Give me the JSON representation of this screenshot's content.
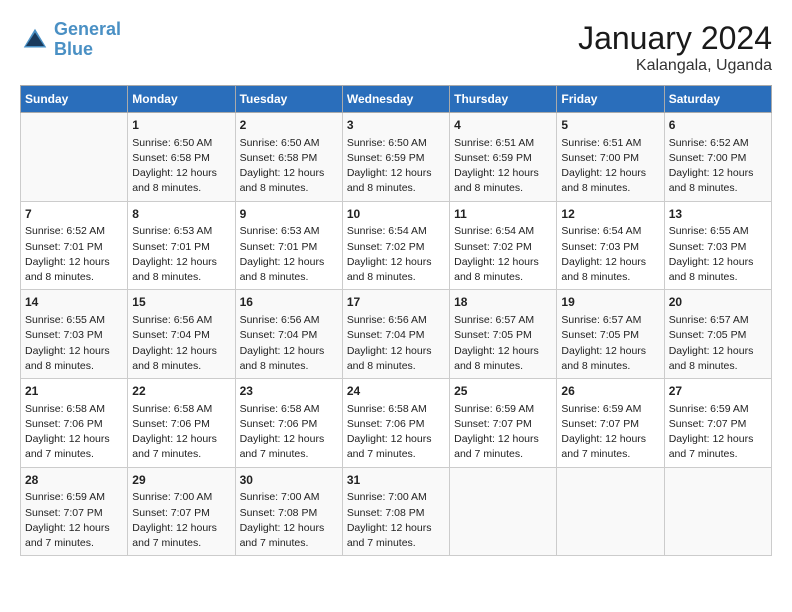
{
  "header": {
    "logo_line1": "General",
    "logo_line2": "Blue",
    "title": "January 2024",
    "subtitle": "Kalangala, Uganda"
  },
  "days_of_week": [
    "Sunday",
    "Monday",
    "Tuesday",
    "Wednesday",
    "Thursday",
    "Friday",
    "Saturday"
  ],
  "weeks": [
    [
      {
        "day": "",
        "info": ""
      },
      {
        "day": "1",
        "info": "Sunrise: 6:50 AM\nSunset: 6:58 PM\nDaylight: 12 hours\nand 8 minutes."
      },
      {
        "day": "2",
        "info": "Sunrise: 6:50 AM\nSunset: 6:58 PM\nDaylight: 12 hours\nand 8 minutes."
      },
      {
        "day": "3",
        "info": "Sunrise: 6:50 AM\nSunset: 6:59 PM\nDaylight: 12 hours\nand 8 minutes."
      },
      {
        "day": "4",
        "info": "Sunrise: 6:51 AM\nSunset: 6:59 PM\nDaylight: 12 hours\nand 8 minutes."
      },
      {
        "day": "5",
        "info": "Sunrise: 6:51 AM\nSunset: 7:00 PM\nDaylight: 12 hours\nand 8 minutes."
      },
      {
        "day": "6",
        "info": "Sunrise: 6:52 AM\nSunset: 7:00 PM\nDaylight: 12 hours\nand 8 minutes."
      }
    ],
    [
      {
        "day": "7",
        "info": "Sunrise: 6:52 AM\nSunset: 7:01 PM\nDaylight: 12 hours\nand 8 minutes."
      },
      {
        "day": "8",
        "info": "Sunrise: 6:53 AM\nSunset: 7:01 PM\nDaylight: 12 hours\nand 8 minutes."
      },
      {
        "day": "9",
        "info": "Sunrise: 6:53 AM\nSunset: 7:01 PM\nDaylight: 12 hours\nand 8 minutes."
      },
      {
        "day": "10",
        "info": "Sunrise: 6:54 AM\nSunset: 7:02 PM\nDaylight: 12 hours\nand 8 minutes."
      },
      {
        "day": "11",
        "info": "Sunrise: 6:54 AM\nSunset: 7:02 PM\nDaylight: 12 hours\nand 8 minutes."
      },
      {
        "day": "12",
        "info": "Sunrise: 6:54 AM\nSunset: 7:03 PM\nDaylight: 12 hours\nand 8 minutes."
      },
      {
        "day": "13",
        "info": "Sunrise: 6:55 AM\nSunset: 7:03 PM\nDaylight: 12 hours\nand 8 minutes."
      }
    ],
    [
      {
        "day": "14",
        "info": "Sunrise: 6:55 AM\nSunset: 7:03 PM\nDaylight: 12 hours\nand 8 minutes."
      },
      {
        "day": "15",
        "info": "Sunrise: 6:56 AM\nSunset: 7:04 PM\nDaylight: 12 hours\nand 8 minutes."
      },
      {
        "day": "16",
        "info": "Sunrise: 6:56 AM\nSunset: 7:04 PM\nDaylight: 12 hours\nand 8 minutes."
      },
      {
        "day": "17",
        "info": "Sunrise: 6:56 AM\nSunset: 7:04 PM\nDaylight: 12 hours\nand 8 minutes."
      },
      {
        "day": "18",
        "info": "Sunrise: 6:57 AM\nSunset: 7:05 PM\nDaylight: 12 hours\nand 8 minutes."
      },
      {
        "day": "19",
        "info": "Sunrise: 6:57 AM\nSunset: 7:05 PM\nDaylight: 12 hours\nand 8 minutes."
      },
      {
        "day": "20",
        "info": "Sunrise: 6:57 AM\nSunset: 7:05 PM\nDaylight: 12 hours\nand 8 minutes."
      }
    ],
    [
      {
        "day": "21",
        "info": "Sunrise: 6:58 AM\nSunset: 7:06 PM\nDaylight: 12 hours\nand 7 minutes."
      },
      {
        "day": "22",
        "info": "Sunrise: 6:58 AM\nSunset: 7:06 PM\nDaylight: 12 hours\nand 7 minutes."
      },
      {
        "day": "23",
        "info": "Sunrise: 6:58 AM\nSunset: 7:06 PM\nDaylight: 12 hours\nand 7 minutes."
      },
      {
        "day": "24",
        "info": "Sunrise: 6:58 AM\nSunset: 7:06 PM\nDaylight: 12 hours\nand 7 minutes."
      },
      {
        "day": "25",
        "info": "Sunrise: 6:59 AM\nSunset: 7:07 PM\nDaylight: 12 hours\nand 7 minutes."
      },
      {
        "day": "26",
        "info": "Sunrise: 6:59 AM\nSunset: 7:07 PM\nDaylight: 12 hours\nand 7 minutes."
      },
      {
        "day": "27",
        "info": "Sunrise: 6:59 AM\nSunset: 7:07 PM\nDaylight: 12 hours\nand 7 minutes."
      }
    ],
    [
      {
        "day": "28",
        "info": "Sunrise: 6:59 AM\nSunset: 7:07 PM\nDaylight: 12 hours\nand 7 minutes."
      },
      {
        "day": "29",
        "info": "Sunrise: 7:00 AM\nSunset: 7:07 PM\nDaylight: 12 hours\nand 7 minutes."
      },
      {
        "day": "30",
        "info": "Sunrise: 7:00 AM\nSunset: 7:08 PM\nDaylight: 12 hours\nand 7 minutes."
      },
      {
        "day": "31",
        "info": "Sunrise: 7:00 AM\nSunset: 7:08 PM\nDaylight: 12 hours\nand 7 minutes."
      },
      {
        "day": "",
        "info": ""
      },
      {
        "day": "",
        "info": ""
      },
      {
        "day": "",
        "info": ""
      }
    ]
  ]
}
